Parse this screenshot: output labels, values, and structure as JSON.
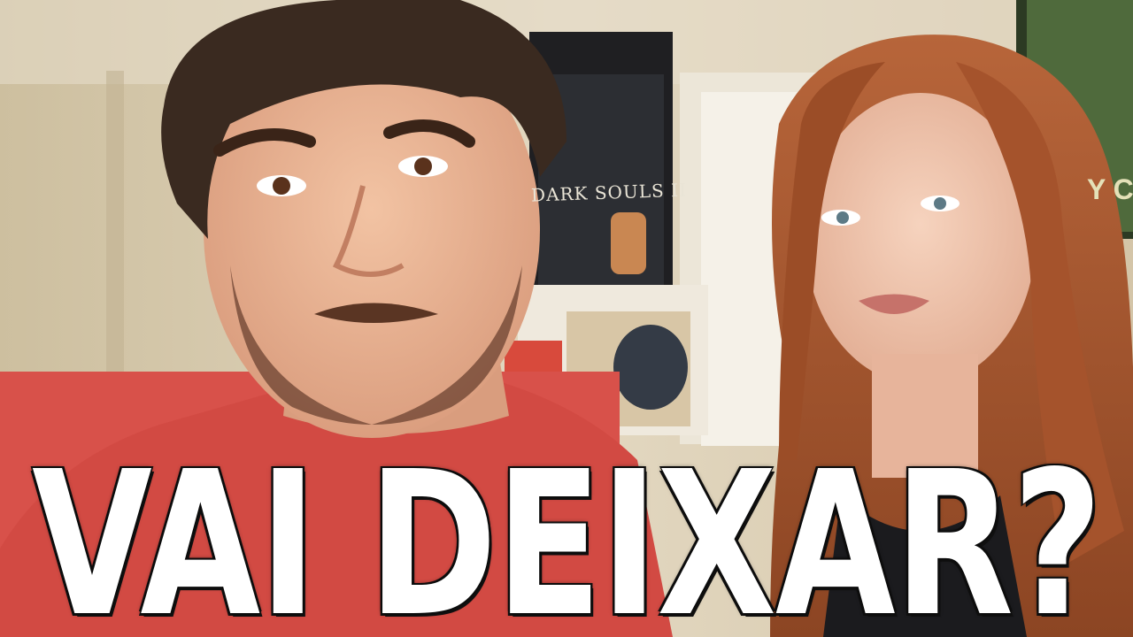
{
  "thumbnail": {
    "caption": "VAI DEIXAR?",
    "poster_text": "DARK SOULS II",
    "poster2_text": "Y C"
  },
  "colors": {
    "wall": "#d9ccb1",
    "caption_fill": "#ffffff",
    "caption_outline": "#111111",
    "shirt": "#d8514a",
    "hair_left": "#3a2a20",
    "hair_right": "#a5532c"
  }
}
